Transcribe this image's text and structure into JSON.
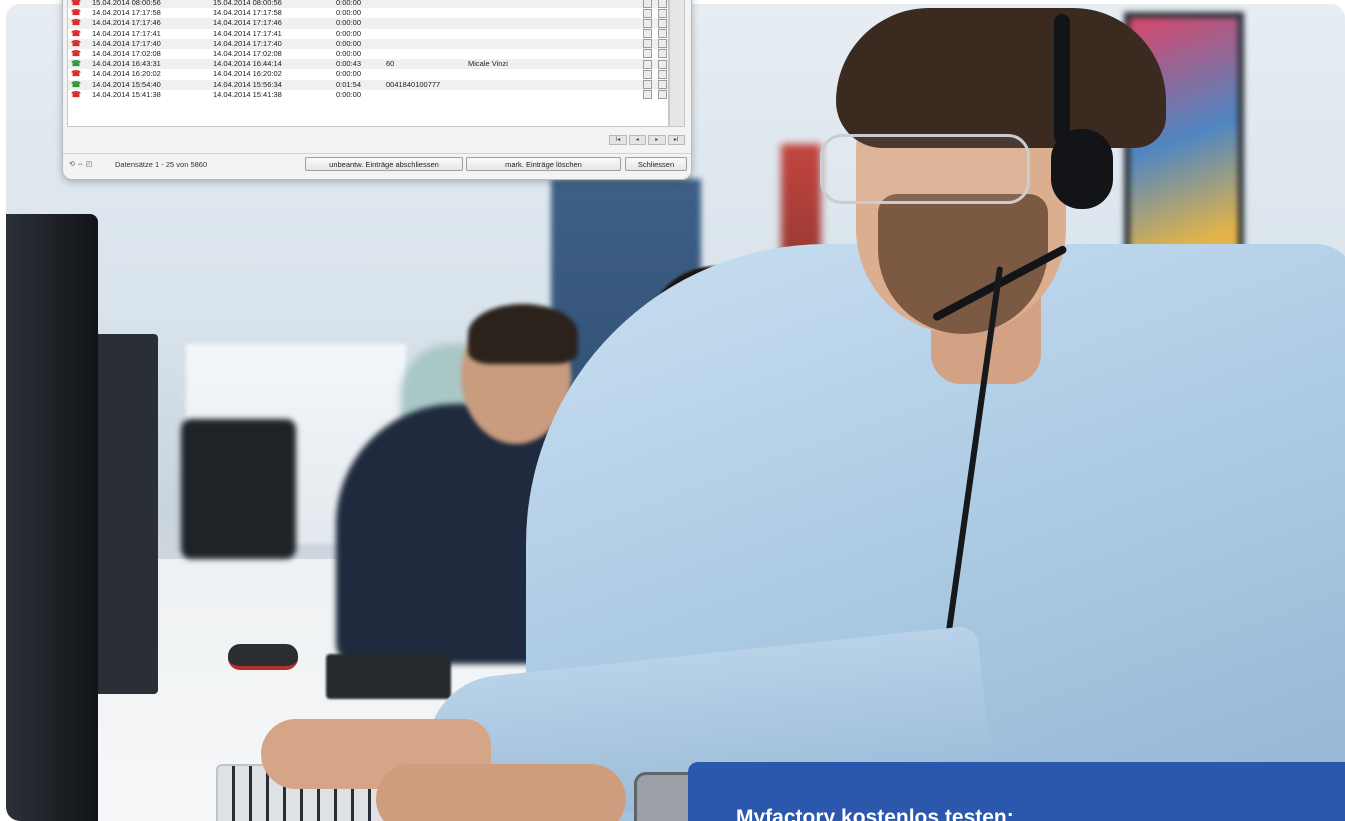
{
  "journal": {
    "rows": [
      {
        "status": "missed",
        "start": "15.04.2014 08:00:56",
        "end": "15.04.2014 08:00:56",
        "duration": "0:00:00",
        "number": "",
        "name": ""
      },
      {
        "status": "missed",
        "start": "14.04.2014 17:17:58",
        "end": "14.04.2014 17:17:58",
        "duration": "0:00:00",
        "number": "",
        "name": ""
      },
      {
        "status": "missed",
        "start": "14.04.2014 17:17:46",
        "end": "14.04.2014 17:17:46",
        "duration": "0:00:00",
        "number": "",
        "name": ""
      },
      {
        "status": "missed",
        "start": "14.04.2014 17:17:41",
        "end": "14.04.2014 17:17:41",
        "duration": "0:00:00",
        "number": "",
        "name": ""
      },
      {
        "status": "missed",
        "start": "14.04.2014 17:17:40",
        "end": "14.04.2014 17:17:40",
        "duration": "0:00:00",
        "number": "",
        "name": ""
      },
      {
        "status": "missed",
        "start": "14.04.2014 17:02:08",
        "end": "14.04.2014 17:02:08",
        "duration": "0:00:00",
        "number": "",
        "name": ""
      },
      {
        "status": "answered",
        "start": "14.04.2014 16:43:31",
        "end": "14.04.2014 16:44:14",
        "duration": "0:00:43",
        "number": "60",
        "name": "Micale Vinzi"
      },
      {
        "status": "missed",
        "start": "14.04.2014 16:20:02",
        "end": "14.04.2014 16:20:02",
        "duration": "0:00:00",
        "number": "",
        "name": ""
      },
      {
        "status": "answered",
        "start": "14.04.2014 15:54:40",
        "end": "14.04.2014 15:56:34",
        "duration": "0:01:54",
        "number": "0041840100777",
        "name": ""
      },
      {
        "status": "missed",
        "start": "14.04.2014 15:41:38",
        "end": "14.04.2014 15:41:38",
        "duration": "0:00:00",
        "number": "",
        "name": ""
      }
    ],
    "status_colors": {
      "missed": "#d62b2b",
      "answered": "#2e9b3a"
    },
    "phone_glyph": "☎",
    "nav_icons": "⟲ ⇔ ◰",
    "pager_first": "I◂",
    "pager_prev": "◂",
    "pager_next": "▸",
    "pager_last": "▸I",
    "record_count": "Datensätze 1 - 25 von 5860",
    "btn_close_unanswered": "unbeantw. Einträge abschliessen",
    "btn_delete_marked": "mark. Einträge löschen",
    "btn_close": "Schliessen"
  },
  "cta": {
    "title": "Myfactory kostenlos testen:",
    "background": "#2b57ad"
  }
}
